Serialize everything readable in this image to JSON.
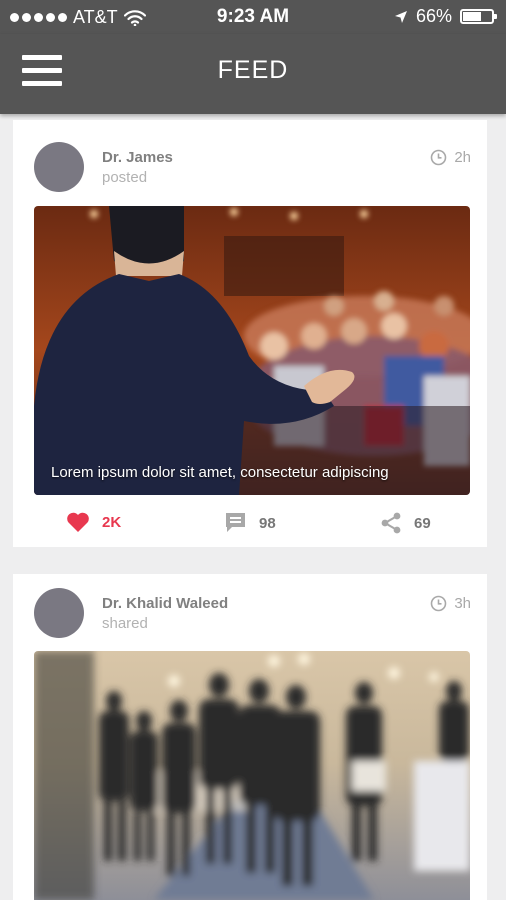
{
  "status_bar": {
    "carrier": "AT&T",
    "time": "9:23 AM",
    "battery": "66%",
    "battery_level": 0.66,
    "icons": [
      "signal-dots-icon",
      "wifi-icon",
      "location-arrow-icon",
      "battery-icon"
    ]
  },
  "header": {
    "title": "FEED",
    "menu_icon": "hamburger-menu-icon"
  },
  "colors": {
    "bar": "#555555",
    "background": "#eeeeef",
    "like_accent": "#e8384f",
    "avatar": "#7a7882",
    "muted_text": "#b2b2b2"
  },
  "posts": [
    {
      "author": "Dr. James",
      "action": "posted",
      "time_ago": "2h",
      "image": "speaker-at-conference-photo",
      "caption": "Lorem ipsum dolor sit amet, consectetur adipiscing",
      "likes": "2K",
      "comments": "98",
      "shares": "69"
    },
    {
      "author": "Dr. Khalid Waleed",
      "action": "shared",
      "time_ago": "3h",
      "image": "blurred-event-crowd-photo"
    }
  ]
}
